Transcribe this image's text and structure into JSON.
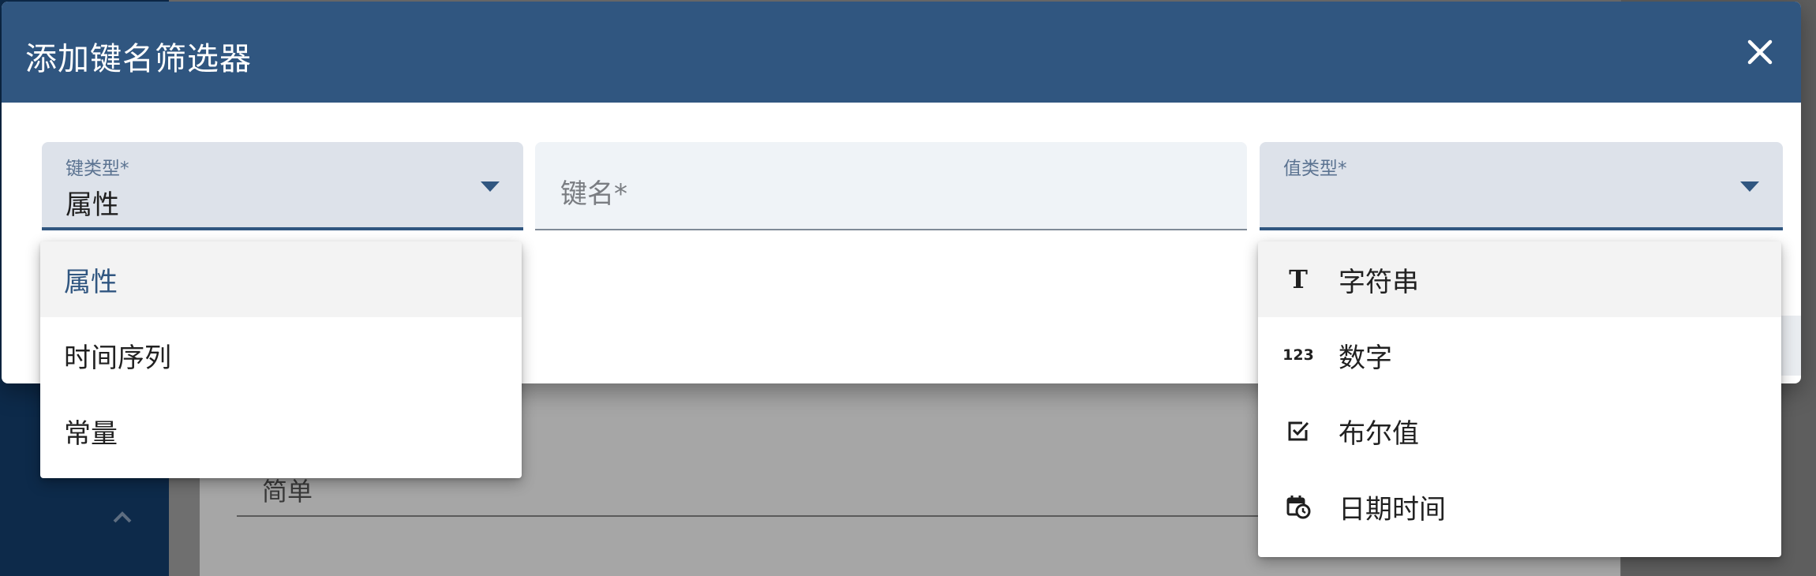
{
  "dialog": {
    "title": "添加键名筛选器"
  },
  "fields": {
    "key_type": {
      "label": "键类型*",
      "value": "属性"
    },
    "key_name": {
      "placeholder": "键名*"
    },
    "value_type": {
      "label": "值类型*",
      "value": ""
    }
  },
  "key_type_menu": {
    "items": [
      {
        "label": "属性",
        "selected": true
      },
      {
        "label": "时间序列",
        "selected": false
      },
      {
        "label": "常量",
        "selected": false
      }
    ]
  },
  "value_type_menu": {
    "items": [
      {
        "label": "字符串",
        "icon": "text-icon",
        "glyph": "T"
      },
      {
        "label": "数字",
        "icon": "number-icon",
        "glyph": "123"
      },
      {
        "label": "布尔值",
        "icon": "checkbox-icon"
      },
      {
        "label": "日期时间",
        "icon": "calendar-clock-icon"
      }
    ]
  },
  "background": {
    "field_value": "简单"
  },
  "colors": {
    "header": "#305680",
    "accent": "#305680",
    "field_bg": "#dde2ea"
  }
}
